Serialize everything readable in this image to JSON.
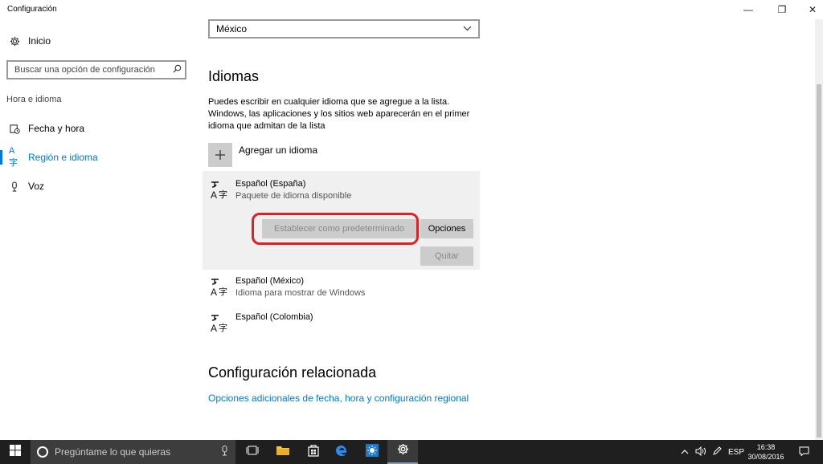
{
  "window": {
    "title": "Configuración",
    "minimize_glyph": "—",
    "restore_glyph": "❐",
    "close_glyph": "✕"
  },
  "sidebar": {
    "home_label": "Inicio",
    "search_placeholder": "Buscar una opción de configuración",
    "section_label": "Hora e idioma",
    "items": [
      {
        "label": "Fecha y hora",
        "icon": "clock-icon"
      },
      {
        "label": "Región e idioma",
        "icon": "region-language-icon",
        "active": true
      },
      {
        "label": "Voz",
        "icon": "microphone-icon"
      }
    ]
  },
  "main": {
    "country_value": "México",
    "languages_heading": "Idiomas",
    "languages_description": "Puedes escribir en cualquier idioma que se agregue a la lista. Windows, las aplicaciones y los sitios web aparecerán en el primer idioma que admitan de la lista",
    "add_language_label": "Agregar un idioma",
    "languages": [
      {
        "name": "Español (España)",
        "status": "Paquete de idioma disponible",
        "selected": true
      },
      {
        "name": "Español (México)",
        "status": "Idioma para mostrar de Windows"
      },
      {
        "name": "Español (Colombia)",
        "status": ""
      }
    ],
    "set_default_label": "Establecer como predeterminado",
    "options_label": "Opciones",
    "remove_label": "Quitar",
    "related_heading": "Configuración relacionada",
    "related_link": "Opciones adicionales de fecha, hora y configuración regional"
  },
  "taskbar": {
    "search_placeholder": "Pregúntame lo que quieras",
    "language_indicator": "ESP",
    "time": "16:38",
    "date": "30/08/2016"
  },
  "colors": {
    "accent": "#0078d7",
    "highlight_ring": "#e21f26",
    "taskbar_bg": "#1f1f1f"
  }
}
